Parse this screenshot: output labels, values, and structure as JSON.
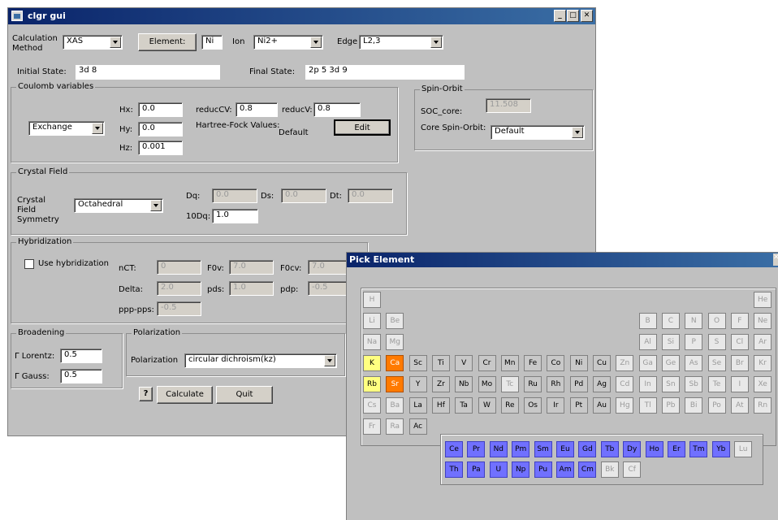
{
  "main_window": {
    "title": "clgr gui",
    "calc_method_label": "Calculation Method",
    "calc_method_value": "XAS",
    "element_button": "Element:",
    "element_value": "Ni",
    "ion_label": "Ion",
    "ion_value": "Ni2+",
    "edge_label": "Edge",
    "edge_value": "L2,3",
    "initial_state_label": "Initial State:",
    "initial_state_value": "3d 8",
    "final_state_label": "Final State:",
    "final_state_value": "2p 5 3d 9",
    "coulomb": {
      "title": "Coulomb variables",
      "mode_value": "Exchange",
      "hx_label": "Hx:",
      "hx_value": "0.0",
      "hy_label": "Hy:",
      "hy_value": "0.0",
      "hz_label": "Hz:",
      "hz_value": "0.001",
      "reduccv_label": "reducCV:",
      "reduccv_value": "0.8",
      "reducv_label": "reducV:",
      "reducv_value": "0.8",
      "hf_label": "Hartree-Fock Values:",
      "hf_value": "Default",
      "edit_button": "Edit"
    },
    "spin_orbit": {
      "title": "Spin-Orbit",
      "soc_label": "SOC_core:",
      "soc_value": "11.508",
      "core_label": "Core Spin-Orbit:",
      "core_value": "Default"
    },
    "crystal_field": {
      "title": "Crystal Field",
      "symmetry_label": "Crystal Field Symmetry",
      "symmetry_value": "Octahedral",
      "dq_label": "Dq:",
      "dq_value": "0.0",
      "ds_label": "Ds:",
      "ds_value": "0.0",
      "dt_label": "Dt:",
      "dt_value": "0.0",
      "tendq_label": "10Dq:",
      "tendq_value": "1.0"
    },
    "hybridization": {
      "title": "Hybridization",
      "use_label": "Use hybridization",
      "nct_label": "nCT:",
      "nct_value": "0",
      "f0v_label": "F0v:",
      "f0v_value": "7.0",
      "f0cv_label": "F0cv:",
      "f0cv_value": "7.0",
      "delta_label": "Delta:",
      "delta_value": "2.0",
      "pds_label": "pds:",
      "pds_value": "1.0",
      "pdp_label": "pdp:",
      "pdp_value": "-0.5",
      "ppp_label": "ppp-pps:",
      "ppp_value": "-0.5"
    },
    "broadening": {
      "title": "Broadening",
      "lorentz_label": "Γ Lorentz:",
      "lorentz_value": "0.5",
      "gauss_label": "Γ Gauss:",
      "gauss_value": "0.5"
    },
    "polarization": {
      "title": "Polarization",
      "label": "Polarization",
      "value": "circular dichroism(kz)"
    },
    "help_button": "?",
    "calculate_button": "Calculate",
    "quit_button": "Quit"
  },
  "pick_window": {
    "title": "Pick Element",
    "elements": [
      {
        "s": "H",
        "r": 0,
        "c": 0,
        "st": "dis"
      },
      {
        "s": "He",
        "r": 0,
        "c": 17,
        "st": "dis"
      },
      {
        "s": "Li",
        "r": 1,
        "c": 0,
        "st": "dis"
      },
      {
        "s": "Be",
        "r": 1,
        "c": 1,
        "st": "dis"
      },
      {
        "s": "B",
        "r": 1,
        "c": 12,
        "st": "dis"
      },
      {
        "s": "C",
        "r": 1,
        "c": 13,
        "st": "dis"
      },
      {
        "s": "N",
        "r": 1,
        "c": 14,
        "st": "dis"
      },
      {
        "s": "O",
        "r": 1,
        "c": 15,
        "st": "dis"
      },
      {
        "s": "F",
        "r": 1,
        "c": 16,
        "st": "dis"
      },
      {
        "s": "Ne",
        "r": 1,
        "c": 17,
        "st": "dis"
      },
      {
        "s": "Na",
        "r": 2,
        "c": 0,
        "st": "dis"
      },
      {
        "s": "Mg",
        "r": 2,
        "c": 1,
        "st": "dis"
      },
      {
        "s": "Al",
        "r": 2,
        "c": 12,
        "st": "dis"
      },
      {
        "s": "Si",
        "r": 2,
        "c": 13,
        "st": "dis"
      },
      {
        "s": "P",
        "r": 2,
        "c": 14,
        "st": "dis"
      },
      {
        "s": "S",
        "r": 2,
        "c": 15,
        "st": "dis"
      },
      {
        "s": "Cl",
        "r": 2,
        "c": 16,
        "st": "dis"
      },
      {
        "s": "Ar",
        "r": 2,
        "c": 17,
        "st": "dis"
      },
      {
        "s": "K",
        "r": 3,
        "c": 0,
        "st": "yellow"
      },
      {
        "s": "Ca",
        "r": 3,
        "c": 1,
        "st": "orange"
      },
      {
        "s": "Sc",
        "r": 3,
        "c": 2,
        "st": "en"
      },
      {
        "s": "Ti",
        "r": 3,
        "c": 3,
        "st": "en"
      },
      {
        "s": "V",
        "r": 3,
        "c": 4,
        "st": "en"
      },
      {
        "s": "Cr",
        "r": 3,
        "c": 5,
        "st": "en"
      },
      {
        "s": "Mn",
        "r": 3,
        "c": 6,
        "st": "en"
      },
      {
        "s": "Fe",
        "r": 3,
        "c": 7,
        "st": "en"
      },
      {
        "s": "Co",
        "r": 3,
        "c": 8,
        "st": "en"
      },
      {
        "s": "Ni",
        "r": 3,
        "c": 9,
        "st": "en"
      },
      {
        "s": "Cu",
        "r": 3,
        "c": 10,
        "st": "en"
      },
      {
        "s": "Zn",
        "r": 3,
        "c": 11,
        "st": "dis"
      },
      {
        "s": "Ga",
        "r": 3,
        "c": 12,
        "st": "dis"
      },
      {
        "s": "Ge",
        "r": 3,
        "c": 13,
        "st": "dis"
      },
      {
        "s": "As",
        "r": 3,
        "c": 14,
        "st": "dis"
      },
      {
        "s": "Se",
        "r": 3,
        "c": 15,
        "st": "dis"
      },
      {
        "s": "Br",
        "r": 3,
        "c": 16,
        "st": "dis"
      },
      {
        "s": "Kr",
        "r": 3,
        "c": 17,
        "st": "dis"
      },
      {
        "s": "Rb",
        "r": 4,
        "c": 0,
        "st": "yellow"
      },
      {
        "s": "Sr",
        "r": 4,
        "c": 1,
        "st": "orange"
      },
      {
        "s": "Y",
        "r": 4,
        "c": 2,
        "st": "en"
      },
      {
        "s": "Zr",
        "r": 4,
        "c": 3,
        "st": "en"
      },
      {
        "s": "Nb",
        "r": 4,
        "c": 4,
        "st": "en"
      },
      {
        "s": "Mo",
        "r": 4,
        "c": 5,
        "st": "en"
      },
      {
        "s": "Tc",
        "r": 4,
        "c": 6,
        "st": "dis"
      },
      {
        "s": "Ru",
        "r": 4,
        "c": 7,
        "st": "en"
      },
      {
        "s": "Rh",
        "r": 4,
        "c": 8,
        "st": "en"
      },
      {
        "s": "Pd",
        "r": 4,
        "c": 9,
        "st": "en"
      },
      {
        "s": "Ag",
        "r": 4,
        "c": 10,
        "st": "en"
      },
      {
        "s": "Cd",
        "r": 4,
        "c": 11,
        "st": "dis"
      },
      {
        "s": "In",
        "r": 4,
        "c": 12,
        "st": "dis"
      },
      {
        "s": "Sn",
        "r": 4,
        "c": 13,
        "st": "dis"
      },
      {
        "s": "Sb",
        "r": 4,
        "c": 14,
        "st": "dis"
      },
      {
        "s": "Te",
        "r": 4,
        "c": 15,
        "st": "dis"
      },
      {
        "s": "I",
        "r": 4,
        "c": 16,
        "st": "dis"
      },
      {
        "s": "Xe",
        "r": 4,
        "c": 17,
        "st": "dis"
      },
      {
        "s": "Cs",
        "r": 5,
        "c": 0,
        "st": "dis"
      },
      {
        "s": "Ba",
        "r": 5,
        "c": 1,
        "st": "dis"
      },
      {
        "s": "La",
        "r": 5,
        "c": 2,
        "st": "en"
      },
      {
        "s": "Hf",
        "r": 5,
        "c": 3,
        "st": "en"
      },
      {
        "s": "Ta",
        "r": 5,
        "c": 4,
        "st": "en"
      },
      {
        "s": "W",
        "r": 5,
        "c": 5,
        "st": "en"
      },
      {
        "s": "Re",
        "r": 5,
        "c": 6,
        "st": "en"
      },
      {
        "s": "Os",
        "r": 5,
        "c": 7,
        "st": "en"
      },
      {
        "s": "Ir",
        "r": 5,
        "c": 8,
        "st": "en"
      },
      {
        "s": "Pt",
        "r": 5,
        "c": 9,
        "st": "en"
      },
      {
        "s": "Au",
        "r": 5,
        "c": 10,
        "st": "en"
      },
      {
        "s": "Hg",
        "r": 5,
        "c": 11,
        "st": "dis"
      },
      {
        "s": "Tl",
        "r": 5,
        "c": 12,
        "st": "dis"
      },
      {
        "s": "Pb",
        "r": 5,
        "c": 13,
        "st": "dis"
      },
      {
        "s": "Bi",
        "r": 5,
        "c": 14,
        "st": "dis"
      },
      {
        "s": "Po",
        "r": 5,
        "c": 15,
        "st": "dis"
      },
      {
        "s": "At",
        "r": 5,
        "c": 16,
        "st": "dis"
      },
      {
        "s": "Rn",
        "r": 5,
        "c": 17,
        "st": "dis"
      },
      {
        "s": "Fr",
        "r": 6,
        "c": 0,
        "st": "dis"
      },
      {
        "s": "Ra",
        "r": 6,
        "c": 1,
        "st": "dis"
      },
      {
        "s": "Ac",
        "r": 6,
        "c": 2,
        "st": "en"
      },
      {
        "s": "Ce",
        "r": 7,
        "c": 0,
        "st": "blue"
      },
      {
        "s": "Pr",
        "r": 7,
        "c": 1,
        "st": "blue"
      },
      {
        "s": "Nd",
        "r": 7,
        "c": 2,
        "st": "blue"
      },
      {
        "s": "Pm",
        "r": 7,
        "c": 3,
        "st": "blue"
      },
      {
        "s": "Sm",
        "r": 7,
        "c": 4,
        "st": "blue"
      },
      {
        "s": "Eu",
        "r": 7,
        "c": 5,
        "st": "blue"
      },
      {
        "s": "Gd",
        "r": 7,
        "c": 6,
        "st": "blue"
      },
      {
        "s": "Tb",
        "r": 7,
        "c": 7,
        "st": "blue"
      },
      {
        "s": "Dy",
        "r": 7,
        "c": 8,
        "st": "blue"
      },
      {
        "s": "Ho",
        "r": 7,
        "c": 9,
        "st": "blue"
      },
      {
        "s": "Er",
        "r": 7,
        "c": 10,
        "st": "blue"
      },
      {
        "s": "Tm",
        "r": 7,
        "c": 11,
        "st": "blue"
      },
      {
        "s": "Yb",
        "r": 7,
        "c": 12,
        "st": "blue"
      },
      {
        "s": "Lu",
        "r": 7,
        "c": 13,
        "st": "dis"
      },
      {
        "s": "Th",
        "r": 8,
        "c": 0,
        "st": "blue"
      },
      {
        "s": "Pa",
        "r": 8,
        "c": 1,
        "st": "blue"
      },
      {
        "s": "U",
        "r": 8,
        "c": 2,
        "st": "blue"
      },
      {
        "s": "Np",
        "r": 8,
        "c": 3,
        "st": "blue"
      },
      {
        "s": "Pu",
        "r": 8,
        "c": 4,
        "st": "blue"
      },
      {
        "s": "Am",
        "r": 8,
        "c": 5,
        "st": "blue"
      },
      {
        "s": "Cm",
        "r": 8,
        "c": 6,
        "st": "blue"
      },
      {
        "s": "Bk",
        "r": 8,
        "c": 7,
        "st": "dis"
      },
      {
        "s": "Cf",
        "r": 8,
        "c": 8,
        "st": "dis"
      }
    ]
  },
  "colors": {
    "title_bar": "#0a246a",
    "window_bg": "#c0c0c0",
    "alkaline_highlight": "#ff7a00",
    "alkali_highlight": "#ffff80",
    "rare_earth_highlight": "#7070ff"
  }
}
